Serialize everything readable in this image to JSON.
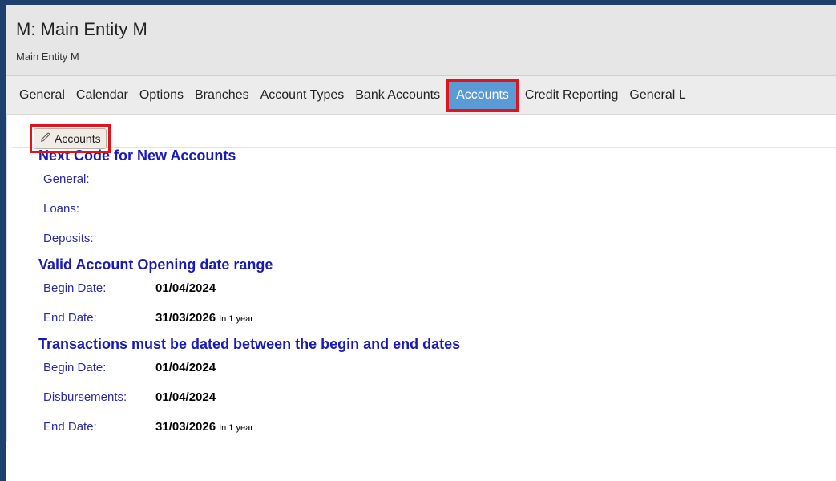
{
  "header": {
    "title": "M: Main Entity M",
    "subtitle": "Main Entity M"
  },
  "tabs": [
    {
      "label": "General"
    },
    {
      "label": "Calendar"
    },
    {
      "label": "Options"
    },
    {
      "label": "Branches"
    },
    {
      "label": "Account Types"
    },
    {
      "label": "Bank Accounts"
    },
    {
      "label": "Accounts",
      "active": true
    },
    {
      "label": "Credit Reporting"
    },
    {
      "label": "General L"
    }
  ],
  "toolbar": {
    "edit_label": "Accounts",
    "edit_icon": "pencil-icon"
  },
  "next_code": {
    "title": "Next Code for New Accounts",
    "rows": [
      {
        "label": "General:",
        "value": ""
      },
      {
        "label": "Loans:",
        "value": ""
      },
      {
        "label": "Deposits:",
        "value": ""
      }
    ]
  },
  "opening_range": {
    "title": "Valid Account Opening date range",
    "rows": [
      {
        "label": "Begin Date:",
        "value": "01/04/2024",
        "note": ""
      },
      {
        "label": "End Date:",
        "value": "31/03/2026",
        "note": "In 1 year"
      }
    ]
  },
  "transactions_range": {
    "title": "Transactions must be dated between the begin and end dates",
    "rows": [
      {
        "label": "Begin Date:",
        "value": "01/04/2024",
        "note": ""
      },
      {
        "label": "Disbursements:",
        "value": "01/04/2024",
        "note": ""
      },
      {
        "label": "End Date:",
        "value": "31/03/2026",
        "note": "In 1 year"
      }
    ]
  },
  "colors": {
    "frame": "#1f3f6e",
    "active_tab": "#5b9bd5",
    "highlight": "#e1141c",
    "section_title": "#1a1ab8"
  }
}
